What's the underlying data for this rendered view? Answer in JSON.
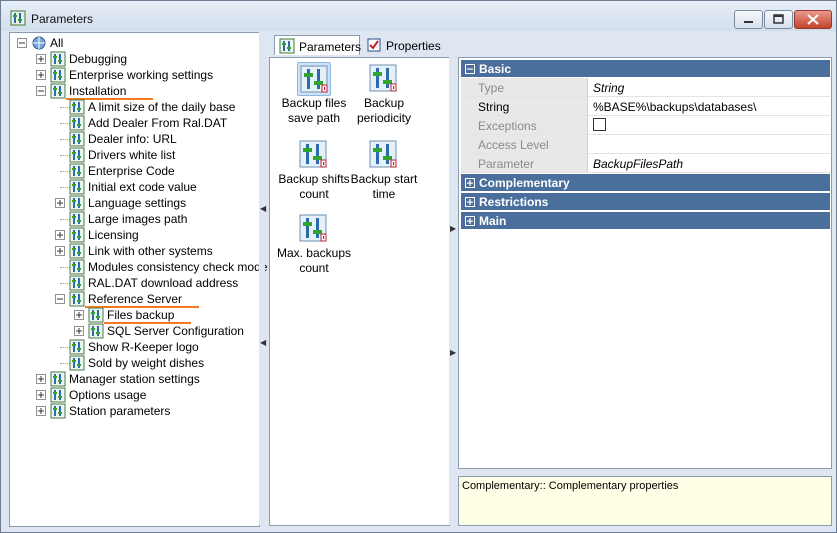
{
  "window": {
    "title": "Parameters"
  },
  "tree": {
    "items": [
      {
        "label": "All",
        "name": "tree-item-all",
        "level": 0,
        "expander": "minus"
      },
      {
        "label": "Debugging",
        "name": "tree-item-debugging",
        "level": 1,
        "expander": "plus"
      },
      {
        "label": "Enterprise working settings",
        "name": "tree-item-enterprise-working-settings",
        "level": 1,
        "expander": "plus"
      },
      {
        "label": "Installation",
        "name": "tree-item-installation",
        "level": 1,
        "expander": "minus",
        "underline": true
      },
      {
        "label": "A limit size of the daily base",
        "name": "tree-item-limit-size",
        "level": 2
      },
      {
        "label": "Add Dealer From Ral.DAT",
        "name": "tree-item-add-dealer",
        "level": 2
      },
      {
        "label": "Dealer info: URL",
        "name": "tree-item-dealer-info",
        "level": 2
      },
      {
        "label": "Drivers white list",
        "name": "tree-item-drivers-white-list",
        "level": 2
      },
      {
        "label": "Enterprise Code",
        "name": "tree-item-enterprise-code",
        "level": 2
      },
      {
        "label": "Initial ext code value",
        "name": "tree-item-initial-ext-code",
        "level": 2
      },
      {
        "label": "Language settings",
        "name": "tree-item-language-settings",
        "level": 2,
        "expander": "plus"
      },
      {
        "label": "Large images path",
        "name": "tree-item-large-images-path",
        "level": 2
      },
      {
        "label": "Licensing",
        "name": "tree-item-licensing",
        "level": 2,
        "expander": "plus"
      },
      {
        "label": "Link with other systems",
        "name": "tree-item-link-other-systems",
        "level": 2,
        "expander": "plus"
      },
      {
        "label": "Modules consistency check mode",
        "name": "tree-item-modules-consistency",
        "level": 2
      },
      {
        "label": "RAL.DAT download address",
        "name": "tree-item-ral-dat-download",
        "level": 2
      },
      {
        "label": "Reference Server",
        "name": "tree-item-reference-server",
        "level": 2,
        "expander": "minus",
        "underline": true
      },
      {
        "label": "Files backup",
        "name": "tree-item-files-backup",
        "level": 3,
        "expander": "plus",
        "underline": true,
        "selected": true
      },
      {
        "label": "SQL Server Configuration",
        "name": "tree-item-sql-server-config",
        "level": 3,
        "expander": "plus"
      },
      {
        "label": "Show R-Keeper logo",
        "name": "tree-item-show-rkeeper-logo",
        "level": 2
      },
      {
        "label": "Sold by weight dishes",
        "name": "tree-item-sold-by-weight",
        "level": 2
      },
      {
        "label": "Manager station settings",
        "name": "tree-item-manager-station",
        "level": 1,
        "expander": "plus"
      },
      {
        "label": "Options usage",
        "name": "tree-item-options-usage",
        "level": 1,
        "expander": "plus"
      },
      {
        "label": "Station parameters",
        "name": "tree-item-station-parameters",
        "level": 1,
        "expander": "plus"
      }
    ]
  },
  "tabs": {
    "parameters_label": "Parameters",
    "properties_label": "Properties"
  },
  "gallery": {
    "items": [
      {
        "label": "Backup files save path",
        "name": "param-backup-files-save-path",
        "selected": true
      },
      {
        "label": "Backup periodicity",
        "name": "param-backup-periodicity"
      },
      {
        "label": "Backup shifts count",
        "name": "param-backup-shifts-count"
      },
      {
        "label": "Backup start time",
        "name": "param-backup-start-time"
      },
      {
        "label": "Max. backups count",
        "name": "param-max-backups-count"
      }
    ]
  },
  "properties": {
    "basic_label": "Basic",
    "rows": {
      "type_name": "Type",
      "type_value": "String",
      "string_name": "String",
      "string_value": "%BASE%\\backups\\databases\\",
      "exceptions_name": "Exceptions",
      "access_level_name": "Access Level",
      "parameter_name": "Parameter",
      "parameter_value": "BackupFilesPath"
    },
    "complementary_label": "Complementary",
    "restrictions_label": "Restrictions",
    "main_label": "Main"
  },
  "description": {
    "text": "Complementary:: Complementary properties"
  },
  "colors": {
    "category_header": "#4a6f9c",
    "underline": "#f47a20",
    "description_bg": "#ffffe6"
  }
}
